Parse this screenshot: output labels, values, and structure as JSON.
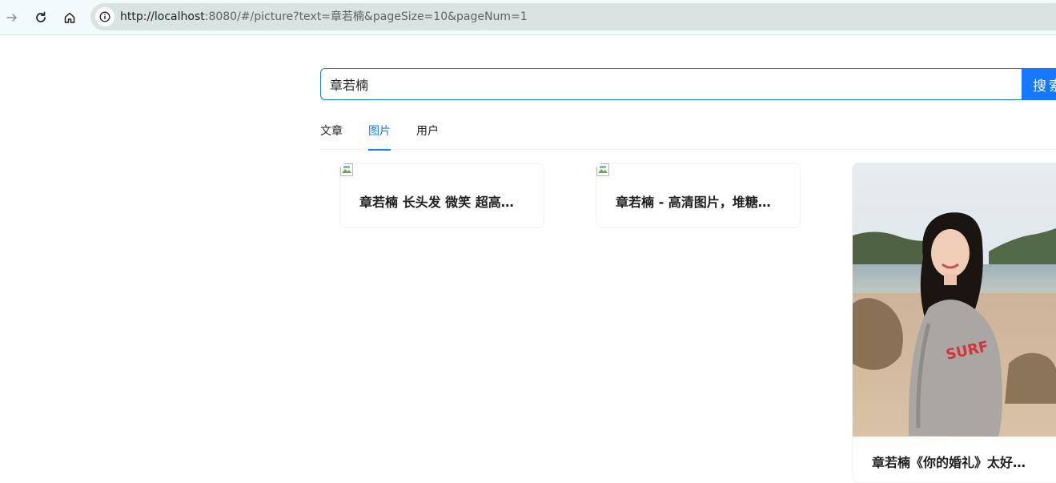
{
  "browser": {
    "url_host": "http://localhost",
    "url_rest": ":8080/#/picture?text=章若楠&pageSize=10&pageNum=1",
    "icons": [
      "forward-icon",
      "reload-icon",
      "home-icon",
      "site-info-icon"
    ]
  },
  "search": {
    "value": "章若楠",
    "button_label": "搜索"
  },
  "tabs": [
    {
      "label": "文章",
      "active": false
    },
    {
      "label": "图片",
      "active": true
    },
    {
      "label": "用户",
      "active": false
    }
  ],
  "pictures": [
    {
      "title": "章若楠 长头发 微笑 超高清壁纸",
      "image": "broken-image-icon"
    },
    {
      "title": "章若楠 - 高清图片，堆糖，美图壁纸",
      "image": "broken-image-icon"
    },
    {
      "title": "章若楠《你的婚礼》太好哭了",
      "image": "photo-woman-grey-sweater-beach"
    }
  ],
  "colors": {
    "accent": "#1677ff",
    "browser_bar": "#f1fbfb",
    "omnibox": "#d9e3e2"
  }
}
